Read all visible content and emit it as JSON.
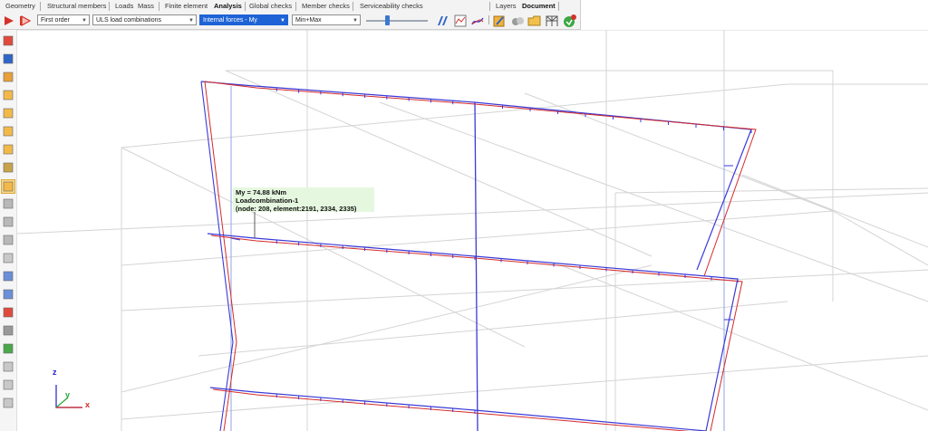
{
  "menu": {
    "items": [
      "Geometry",
      "Structural members",
      "Loads",
      "Mass",
      "Finite element",
      "Analysis",
      "Global checks",
      "Member checks",
      "Serviceability checks",
      "Layers",
      "Document"
    ]
  },
  "toolbar": {
    "order_value": "First order",
    "combination_value": "ULS load combinations",
    "result_value": "Internal forces - My",
    "envelope_value": "Min+Max",
    "icons": [
      "play-red-icon",
      "play-outline-icon",
      "diagram-fa-icon",
      "diagram-chart-icon",
      "graph-icon",
      "report-icon",
      "view-3d-icon",
      "folder-icon",
      "structure-icon",
      "refresh-go-icon"
    ]
  },
  "sidebar": {
    "icons": [
      "save-icon",
      "undo-icon",
      "member-icon",
      "box-icon",
      "box-icon",
      "box-icon",
      "box-icon",
      "grid-icon",
      "open-box-icon",
      "layer-icon",
      "layer-icon",
      "layer-icon",
      "page-icon",
      "section-icon",
      "mirror-icon",
      "node-icon",
      "node-icon",
      "check-icon",
      "sheet-icon",
      "sheet-icon",
      "sheet-icon"
    ]
  },
  "tooltip": {
    "line1": "My = 74.88 kNm",
    "line2": "Loadcombination-1",
    "line3": "(node: 208, element:2191, 2334, 2335)"
  },
  "axes": {
    "z": "z",
    "y": "y",
    "x": "x"
  },
  "colors": {
    "accent": "#1e63d6",
    "diagram_blue": "#3a3ad8",
    "diagram_red": "#d42a2a",
    "grid": "#d4d4d4",
    "tooltip_bg": "#e6f7e0"
  }
}
